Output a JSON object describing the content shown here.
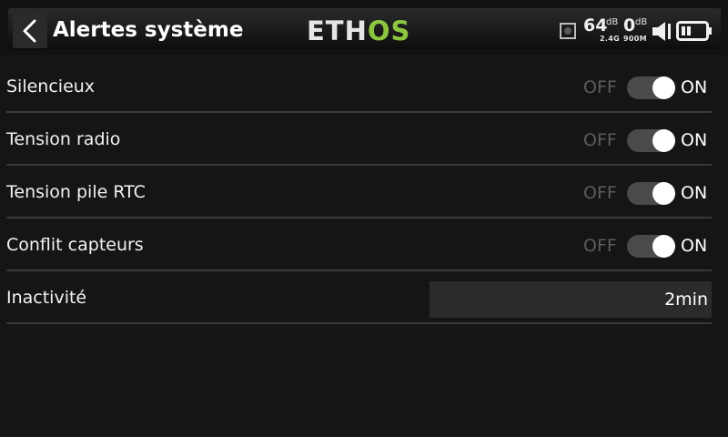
{
  "header": {
    "title": "Alertes système",
    "back_icon": "chevron-left-icon",
    "logo_eth": "ETH",
    "logo_os": "OS",
    "logo_colors": {
      "eth": "#e6e6e6",
      "os": "#8cc63f"
    }
  },
  "status": {
    "rssi_value": "64",
    "rssi_unit": "dB",
    "rssi_band": "2.4G",
    "rssi2_value": "0",
    "rssi2_unit": "dB",
    "rssi2_band": "900M",
    "icons": [
      "signal-icon",
      "speaker-icon",
      "battery-icon"
    ]
  },
  "settings": [
    {
      "label": "Silencieux",
      "off_label": "OFF",
      "on_label": "ON",
      "state": "on"
    },
    {
      "label": "Tension radio",
      "off_label": "OFF",
      "on_label": "ON",
      "state": "on"
    },
    {
      "label": "Tension pile RTC",
      "off_label": "OFF",
      "on_label": "ON",
      "state": "on"
    },
    {
      "label": "Conflit capteurs",
      "off_label": "OFF",
      "on_label": "ON",
      "state": "on"
    }
  ],
  "inactivity": {
    "label": "Inactivité",
    "value": "2min"
  }
}
